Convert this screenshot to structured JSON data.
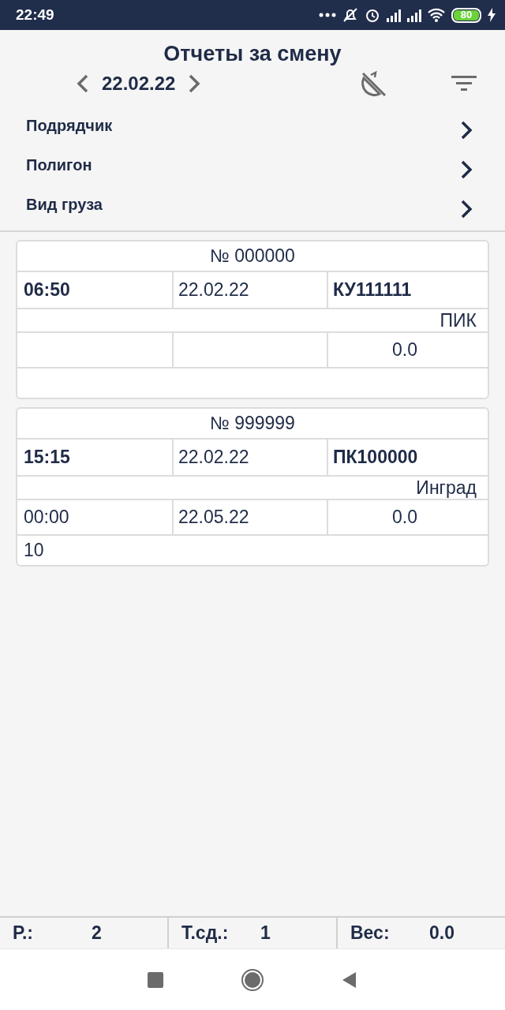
{
  "status_bar": {
    "time": "22:49",
    "battery": "80"
  },
  "header": {
    "title": "Отчеты за смену",
    "date": "22.02.22"
  },
  "filters": [
    {
      "label": "Подрядчик"
    },
    {
      "label": "Полигон"
    },
    {
      "label": "Вид груза"
    }
  ],
  "reports": [
    {
      "number": "№ 000000",
      "time": "06:50",
      "date": "22.02.22",
      "vehicle": "КУ111111",
      "company": "ПИК",
      "weight": "0.0"
    },
    {
      "number": "№ 999999",
      "time": "15:15",
      "date": "22.02.22",
      "vehicle": "ПК100000",
      "company": "Инград",
      "time_2": "00:00",
      "date_2": "22.05.22",
      "weight": "0.0",
      "note": "10"
    }
  ],
  "footer": [
    {
      "label": "Р.:",
      "value": "2"
    },
    {
      "label": "Т.сд.:",
      "value": "1"
    },
    {
      "label": "Вес:",
      "value": "0.0"
    }
  ]
}
